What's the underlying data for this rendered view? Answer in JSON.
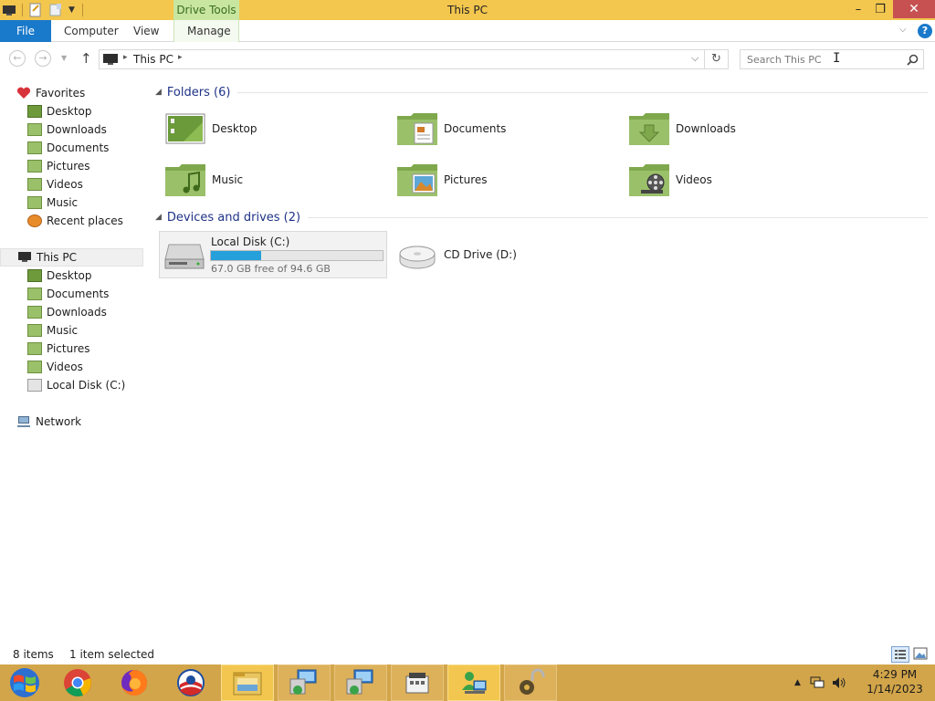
{
  "window": {
    "title": "This PC",
    "contextual_tab": "Drive Tools",
    "minimize_icon": "minimize-icon",
    "restore_icon": "restore-icon",
    "close_icon": "close-icon"
  },
  "ribbon": {
    "tabs": [
      "File",
      "Computer",
      "View",
      "Manage"
    ]
  },
  "address": {
    "crumb": "This PC",
    "search_placeholder": "Search This PC"
  },
  "nav_pane": {
    "favorites": {
      "label": "Favorites",
      "items": [
        "Desktop",
        "Downloads",
        "Documents",
        "Pictures",
        "Videos",
        "Music",
        "Recent places"
      ]
    },
    "this_pc": {
      "label": "This PC",
      "items": [
        "Desktop",
        "Documents",
        "Downloads",
        "Music",
        "Pictures",
        "Videos",
        "Local Disk (C:)"
      ]
    },
    "network": {
      "label": "Network"
    }
  },
  "main": {
    "folders_header": "Folders (6)",
    "folders": [
      "Desktop",
      "Documents",
      "Downloads",
      "Music",
      "Pictures",
      "Videos"
    ],
    "devices_header": "Devices and drives (2)",
    "drives": [
      {
        "name": "Local Disk (C:)",
        "free_text": "67.0 GB free of 94.6 GB",
        "used_fraction": 0.29
      },
      {
        "name": "CD Drive (D:)"
      }
    ]
  },
  "status": {
    "items": "8 items",
    "selected": "1 item selected"
  },
  "taskbar": {
    "apps": [
      "windows-logo-icon",
      "chrome-icon",
      "firefox-icon",
      "obama-icon",
      "file-explorer-icon",
      "remote-desktop-icon",
      "remote-desktop-2-icon",
      "cash-register-icon",
      "network-users-icon",
      "lock-gear-icon"
    ]
  },
  "clock": {
    "time": "4:29 PM",
    "date": "1/14/2023"
  },
  "colors": {
    "titlebar": "#f3c64e",
    "file_tab": "#1979ca",
    "taskbar": "#d2a54a",
    "folder_green": "#8bb35a",
    "progress": "#26a0da"
  }
}
